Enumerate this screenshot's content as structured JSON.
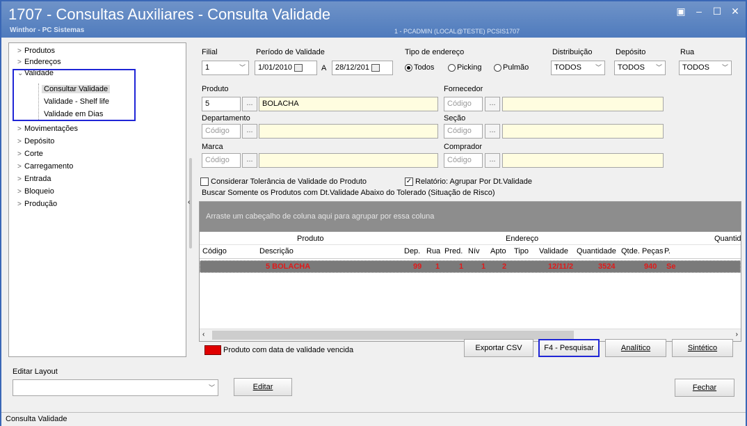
{
  "window": {
    "title": "1707 - Consultas Auxiliares - Consulta Validade",
    "subtitle": "Winthor - PC Sistemas",
    "user_info": "1 - PCADMIN (LOCAL@TESTE)  PCSIS1707",
    "controls": [
      "▣",
      "–",
      "☐",
      "✕"
    ]
  },
  "tree": {
    "items": [
      {
        "label": "Produtos",
        "arrow": ">"
      },
      {
        "label": "Endereços",
        "arrow": ">"
      },
      {
        "label": "Validade",
        "arrow": "⌄"
      },
      {
        "label": "Movimentações",
        "arrow": ">"
      },
      {
        "label": "Depósito",
        "arrow": ">"
      },
      {
        "label": "Corte",
        "arrow": ">"
      },
      {
        "label": "Carregamento",
        "arrow": ">"
      },
      {
        "label": "Entrada",
        "arrow": ">"
      },
      {
        "label": "Bloqueio",
        "arrow": ">"
      },
      {
        "label": "Produção",
        "arrow": ">"
      }
    ],
    "validade_children": [
      "Consultar Validade",
      "Validade - Shelf life",
      "Validade em Dias"
    ]
  },
  "filters": {
    "filial_label": "Filial",
    "filial_value": "1",
    "periodo_label": "Período de Validade",
    "periodo_start": "1/01/2010",
    "periodo_sep": "A",
    "periodo_end": "28/12/201",
    "tipo_label": "Tipo de endereço",
    "tipo_options": [
      "Todos",
      "Picking",
      "Pulmão"
    ],
    "tipo_selected": "Todos",
    "distribuicao_label": "Distribuição",
    "distribuicao_value": "TODOS",
    "deposito_label": "Depósito",
    "deposito_value": "TODOS",
    "rua_label": "Rua",
    "rua_value": "TODOS",
    "produto_label": "Produto",
    "produto_code": "5",
    "produto_desc": "BOLACHA",
    "fornecedor_label": "Fornecedor",
    "departamento_label": "Departamento",
    "secao_label": "Seção",
    "marca_label": "Marca",
    "comprador_label": "Comprador",
    "codigo_placeholder": "Código",
    "dots": "...",
    "tolerancia_label": "Considerar Tolerância de Validade do Produto",
    "tolerancia_checked": false,
    "relatorio_label": "Relatório: Agrupar Por Dt.Validade",
    "relatorio_checked": true,
    "buscar_text": "Buscar Somente os Produtos com Dt.Validade Abaixo do Tolerado (Situação de Risco)"
  },
  "grid": {
    "group_hint": "Arraste um cabeçalho de coluna aqui para agrupar por essa coluna",
    "band_produto": "Produto",
    "band_endereco": "Endereço",
    "band_quantid": "Quantid",
    "columns": [
      "Código",
      "Descrição",
      "Dep.",
      "Rua",
      "Pred.",
      "Nív",
      "Apto",
      "Tipo",
      "Validade",
      "Quantidade",
      "Qtde. Peças",
      "P."
    ],
    "rows": [
      {
        "descricao": "5 BOLACHA",
        "dep": "99",
        "rua": "1",
        "pred": "1",
        "niv": "1",
        "apto": "2",
        "validade": "12/11/2",
        "quantidade": "3524",
        "pecas": "940",
        "p": "Se"
      }
    ]
  },
  "footer": {
    "legend_text": "Produto com data de validade vencida",
    "legend_color": "#e00000",
    "buttons": {
      "exportar": "Exportar CSV",
      "pesquisar": "F4 - Pesquisar",
      "analitico": "Analítico",
      "sintetico": "Sintético"
    }
  },
  "layout": {
    "label": "Editar Layout",
    "edit_button": "Editar",
    "close_button": "Fechar"
  },
  "status": "Consulta Validade"
}
